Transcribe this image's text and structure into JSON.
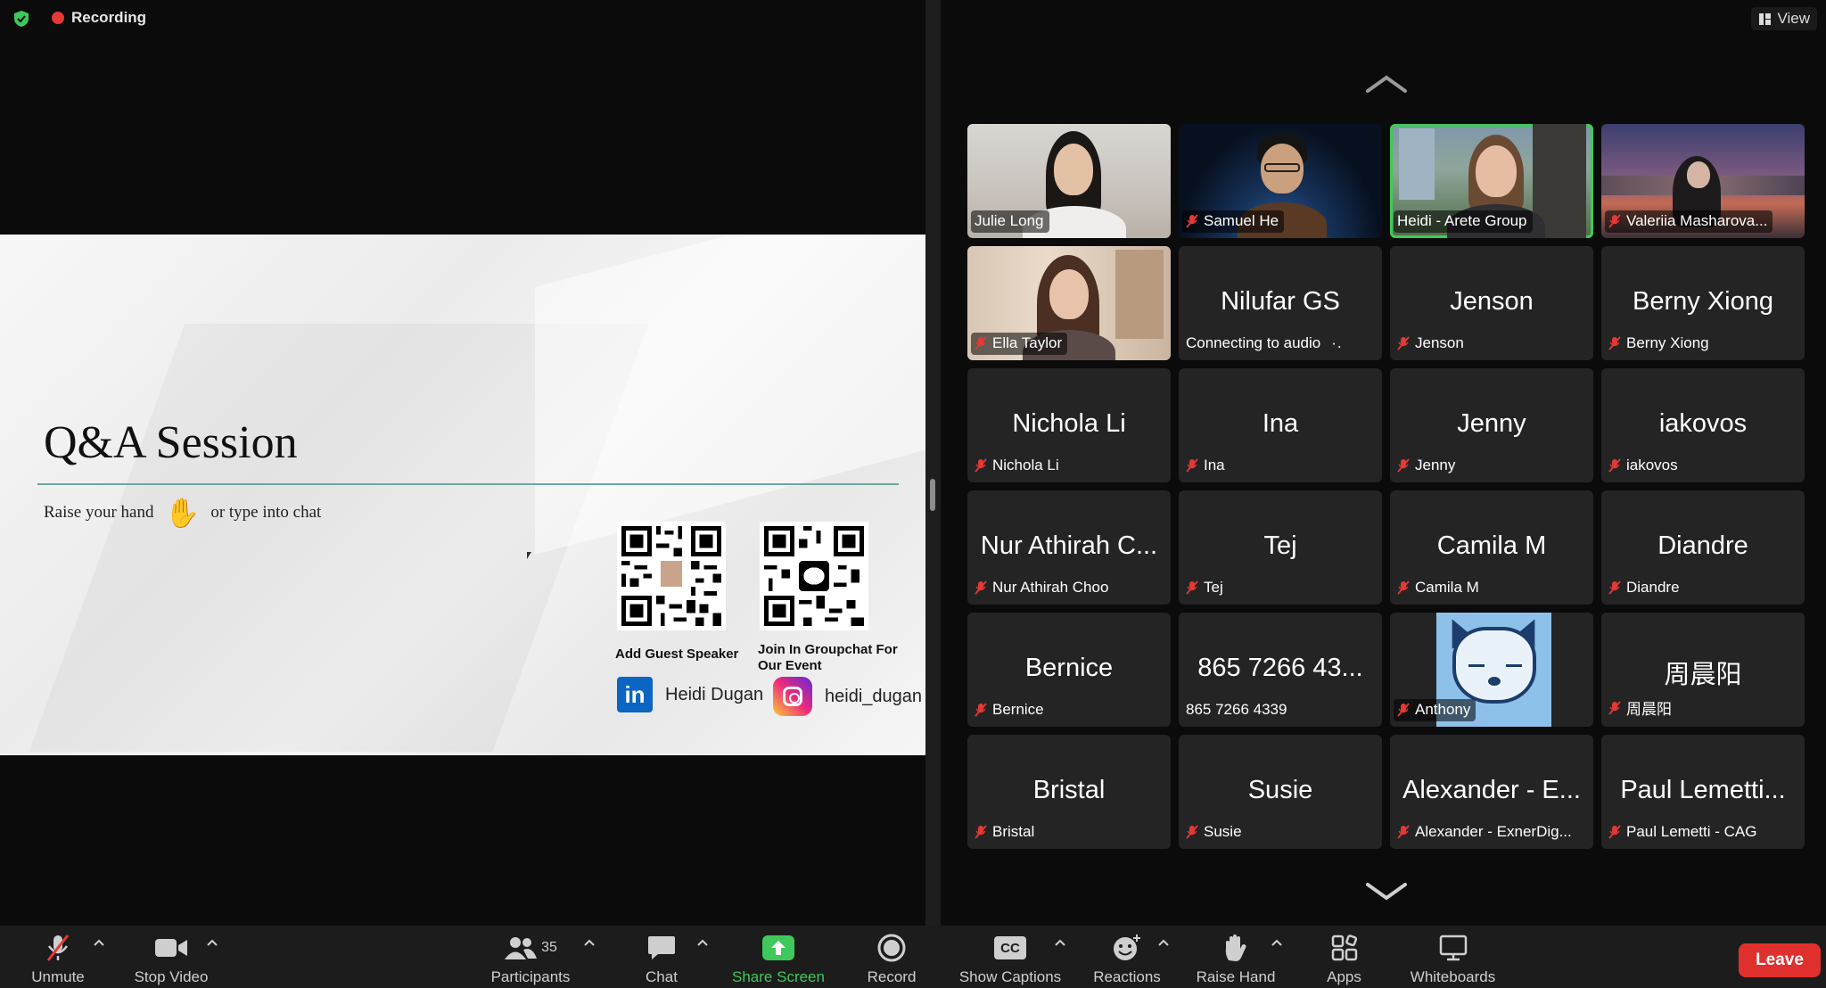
{
  "topbar": {
    "recording_label": "Recording",
    "view_label": "View"
  },
  "slide": {
    "title": "Q&A Session",
    "subtitle_left": "Raise your hand",
    "subtitle_right": "or type into chat",
    "qr1_label": "Add Guest Speaker",
    "qr2_label": "Join In Groupchat For Our Event",
    "linkedin_name": "Heidi Dugan",
    "instagram_handle": "heidi_dugan"
  },
  "gallery": {
    "tiles": [
      {
        "big": "",
        "label": "Julie Long",
        "muted": false
      },
      {
        "big": "",
        "label": "Samuel He",
        "muted": true
      },
      {
        "big": "",
        "label": "Heidi - Arete Group",
        "muted": false
      },
      {
        "big": "",
        "label": "Valeriia Masharova...",
        "muted": true
      },
      {
        "big": "",
        "label": "Ella Taylor",
        "muted": true
      },
      {
        "big": "Nilufar GS",
        "label": "Connecting to audio",
        "muted": false
      },
      {
        "big": "Jenson",
        "label": "Jenson",
        "muted": true
      },
      {
        "big": "Berny Xiong",
        "label": "Berny Xiong",
        "muted": true
      },
      {
        "big": "Nichola Li",
        "label": "Nichola Li",
        "muted": true
      },
      {
        "big": "Ina",
        "label": "Ina",
        "muted": true
      },
      {
        "big": "Jenny",
        "label": "Jenny",
        "muted": true
      },
      {
        "big": "iakovos",
        "label": "iakovos",
        "muted": true
      },
      {
        "big": "Nur Athirah C...",
        "label": "Nur Athirah Choo",
        "muted": true
      },
      {
        "big": "Tej",
        "label": "Tej",
        "muted": true
      },
      {
        "big": "Camila M",
        "label": "Camila M",
        "muted": true
      },
      {
        "big": "Diandre",
        "label": "Diandre",
        "muted": true
      },
      {
        "big": "Bernice",
        "label": "Bernice",
        "muted": true
      },
      {
        "big": "865 7266 43...",
        "label": "865 7266 4339",
        "muted": false
      },
      {
        "big": "",
        "label": "Anthony",
        "muted": true
      },
      {
        "big": "周晨阳",
        "label": "周晨阳",
        "muted": true
      },
      {
        "big": "Bristal",
        "label": "Bristal",
        "muted": true
      },
      {
        "big": "Susie",
        "label": "Susie",
        "muted": true
      },
      {
        "big": "Alexander - E...",
        "label": "Alexander - ExnerDig...",
        "muted": true
      },
      {
        "big": "Paul Lemetti...",
        "label": "Paul Lemetti - CAG",
        "muted": true
      }
    ]
  },
  "toolbar": {
    "unmute": "Unmute",
    "stop_video": "Stop Video",
    "participants": "Participants",
    "participants_count": "35",
    "chat": "Chat",
    "share_screen": "Share Screen",
    "record": "Record",
    "show_captions": "Show Captions",
    "captions_icon_text": "CC",
    "reactions": "Reactions",
    "raise_hand": "Raise Hand",
    "apps": "Apps",
    "whiteboards": "Whiteboards",
    "leave": "Leave"
  },
  "colors": {
    "accent_green": "#3ec95a",
    "leave_red": "#e0302d",
    "muted_red": "#e53935",
    "linkedin_blue": "#0a66c2"
  }
}
